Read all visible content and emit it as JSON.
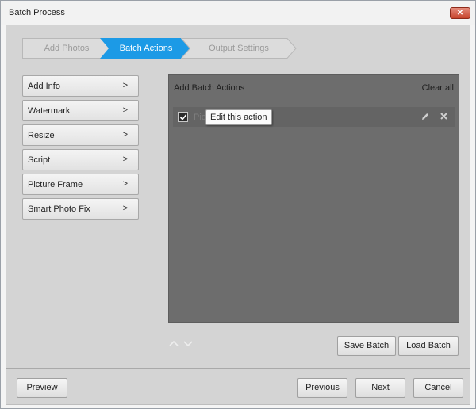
{
  "window": {
    "title": "Batch Process",
    "close_glyph": "✕"
  },
  "steps": [
    {
      "label": "Add Photos",
      "state": "inactive"
    },
    {
      "label": "Batch Actions",
      "state": "active"
    },
    {
      "label": "Output Settings",
      "state": "inactive"
    }
  ],
  "actions": [
    {
      "label": "Add Info",
      "chevron": ">"
    },
    {
      "label": "Watermark",
      "chevron": ">"
    },
    {
      "label": "Resize",
      "chevron": ">"
    },
    {
      "label": "Script",
      "chevron": ">"
    },
    {
      "label": "Picture Frame",
      "chevron": ">"
    },
    {
      "label": "Smart Photo Fix",
      "chevron": ">"
    }
  ],
  "batch_panel": {
    "title": "Add Batch Actions",
    "clear_all": "Clear all",
    "items": [
      {
        "label": "Picture Frame",
        "checked": true
      }
    ],
    "tooltip": "Edit this action"
  },
  "buttons": {
    "save_batch": "Save Batch",
    "load_batch": "Load Batch",
    "preview": "Preview",
    "previous": "Previous",
    "next": "Next",
    "cancel": "Cancel"
  },
  "colors": {
    "accent": "#1c9ae6",
    "panel_bg": "#6d6d6d",
    "client_bg": "#d4d4d4"
  }
}
